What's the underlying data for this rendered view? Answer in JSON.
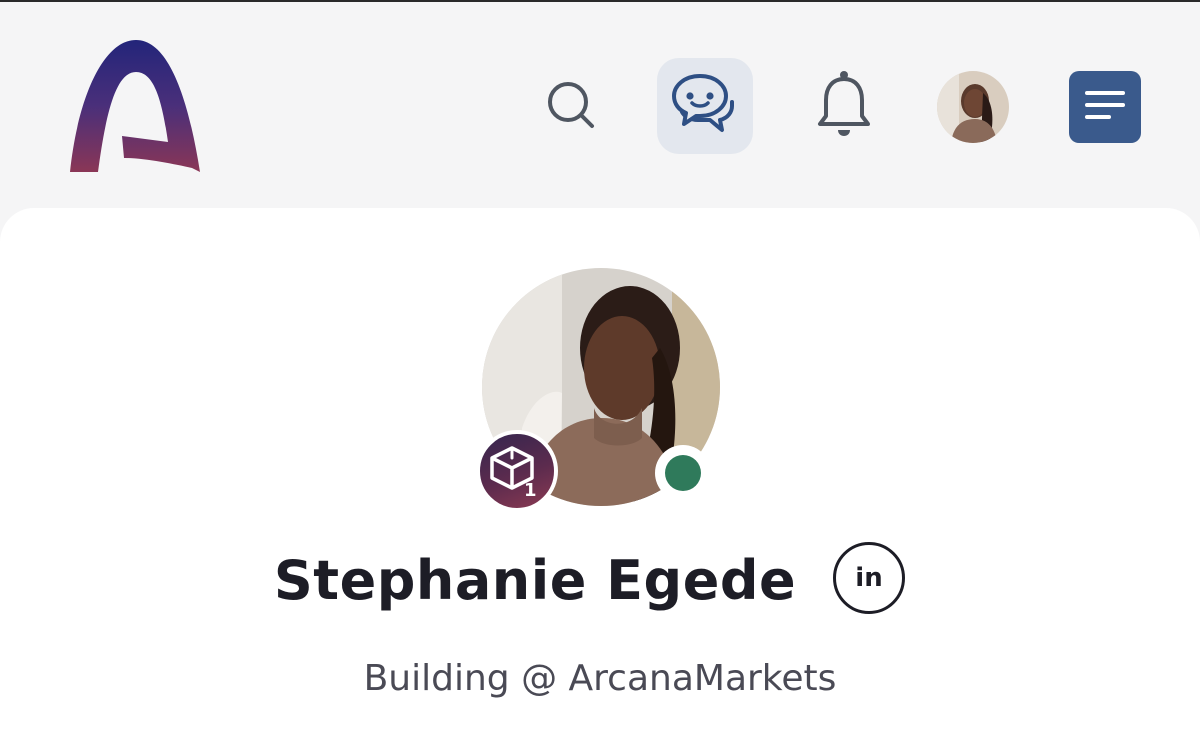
{
  "header": {
    "logo_icon": "arcana-logo",
    "search_icon": "search-icon",
    "messages_icon": "chat-bubbles-icon",
    "notifications_icon": "bell-icon",
    "menu_icon": "menu-lines-icon",
    "menu_color": "#3a5a8c",
    "active_color": "#e3e7ee"
  },
  "profile": {
    "name": "Stephanie Egede",
    "tagline": "Building @ ArcanaMarkets",
    "level_badge_number": "1",
    "linkedin_label": "in",
    "status": "online",
    "status_color": "#2f7a5b"
  }
}
